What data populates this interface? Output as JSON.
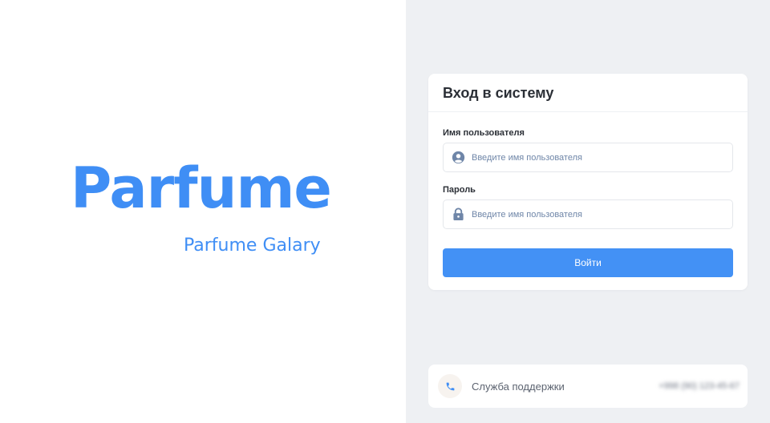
{
  "brand": {
    "title": "Parfume",
    "subtitle": "Parfume Galary",
    "color": "#3f8ef5"
  },
  "login": {
    "title": "Вход в систему",
    "username": {
      "label": "Имя пользователя",
      "placeholder": "Введите имя пользователя",
      "value": "",
      "icon": "user-circle-icon"
    },
    "password": {
      "label": "Пароль",
      "placeholder": "Введите имя пользователя",
      "value": "",
      "icon": "lock-icon"
    },
    "submit_label": "Войти",
    "submit_color": "#4391f5"
  },
  "support": {
    "label": "Служба поддержки",
    "phone": "+998 (90) 123-45-67",
    "icon": "phone-icon"
  }
}
